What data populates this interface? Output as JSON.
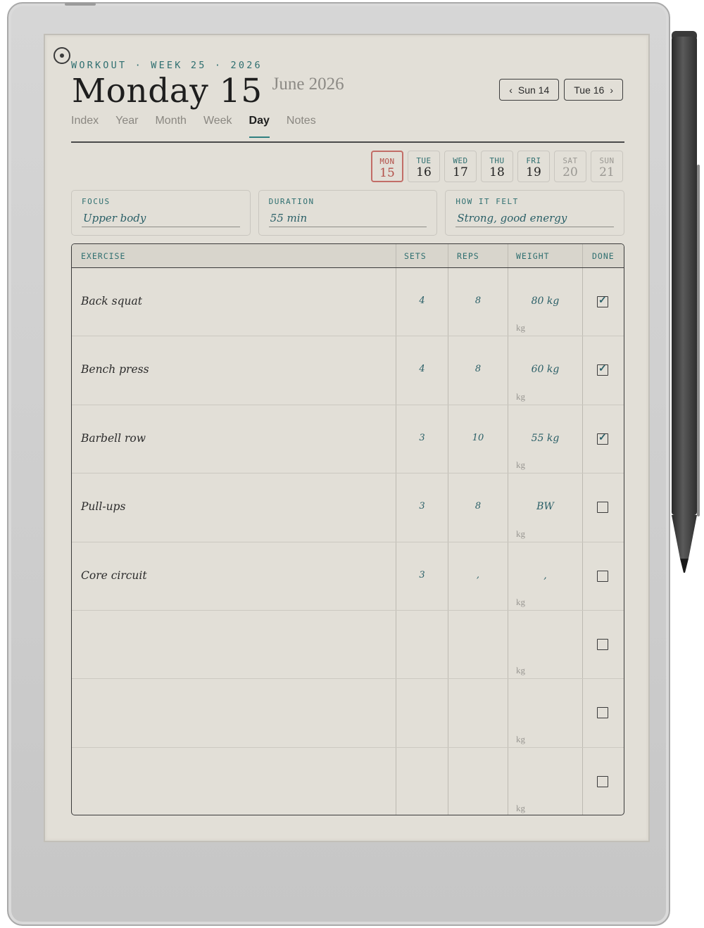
{
  "header": {
    "kicker": "WORKOUT · WEEK 25 · 2026",
    "title": "Monday 15",
    "subtitle": "June 2026",
    "prev_label": "Sun 14",
    "next_label": "Tue 16"
  },
  "tabs": [
    "Index",
    "Year",
    "Month",
    "Week",
    "Day",
    "Notes"
  ],
  "active_tab": "Day",
  "week": [
    {
      "dow": "MON",
      "date": "15",
      "state": "today"
    },
    {
      "dow": "TUE",
      "date": "16",
      "state": "normal"
    },
    {
      "dow": "WED",
      "date": "17",
      "state": "normal"
    },
    {
      "dow": "THU",
      "date": "18",
      "state": "normal"
    },
    {
      "dow": "FRI",
      "date": "19",
      "state": "normal"
    },
    {
      "dow": "SAT",
      "date": "20",
      "state": "weekend"
    },
    {
      "dow": "SUN",
      "date": "21",
      "state": "weekend"
    }
  ],
  "fields": {
    "focus": {
      "label": "FOCUS",
      "value": "Upper body"
    },
    "duration": {
      "label": "DURATION",
      "value": "55 min"
    },
    "felt": {
      "label": "HOW IT FELT",
      "value": "Strong, good energy"
    }
  },
  "table": {
    "headers": {
      "exercise": "EXERCISE",
      "sets": "SETS",
      "reps": "REPS",
      "weight": "WEIGHT",
      "done": "DONE"
    },
    "unit": "kg",
    "rows": [
      {
        "exercise": "Back squat",
        "sets": "4",
        "reps": "8",
        "weight": "80 kg",
        "done": true
      },
      {
        "exercise": "Bench press",
        "sets": "4",
        "reps": "8",
        "weight": "60 kg",
        "done": true
      },
      {
        "exercise": "Barbell row",
        "sets": "3",
        "reps": "10",
        "weight": "55 kg",
        "done": true
      },
      {
        "exercise": "Pull-ups",
        "sets": "3",
        "reps": "8",
        "weight": "BW",
        "done": false
      },
      {
        "exercise": "Core circuit",
        "sets": "3",
        "reps": ",",
        "weight": ",",
        "done": false
      },
      {
        "exercise": "",
        "sets": "",
        "reps": "",
        "weight": "",
        "done": false
      },
      {
        "exercise": "",
        "sets": "",
        "reps": "",
        "weight": "",
        "done": false
      },
      {
        "exercise": "",
        "sets": "",
        "reps": "",
        "weight": "",
        "done": false
      }
    ]
  },
  "colors": {
    "accent": "#2f6f70",
    "today": "#b24f48",
    "paper": "#e2dfd7"
  }
}
